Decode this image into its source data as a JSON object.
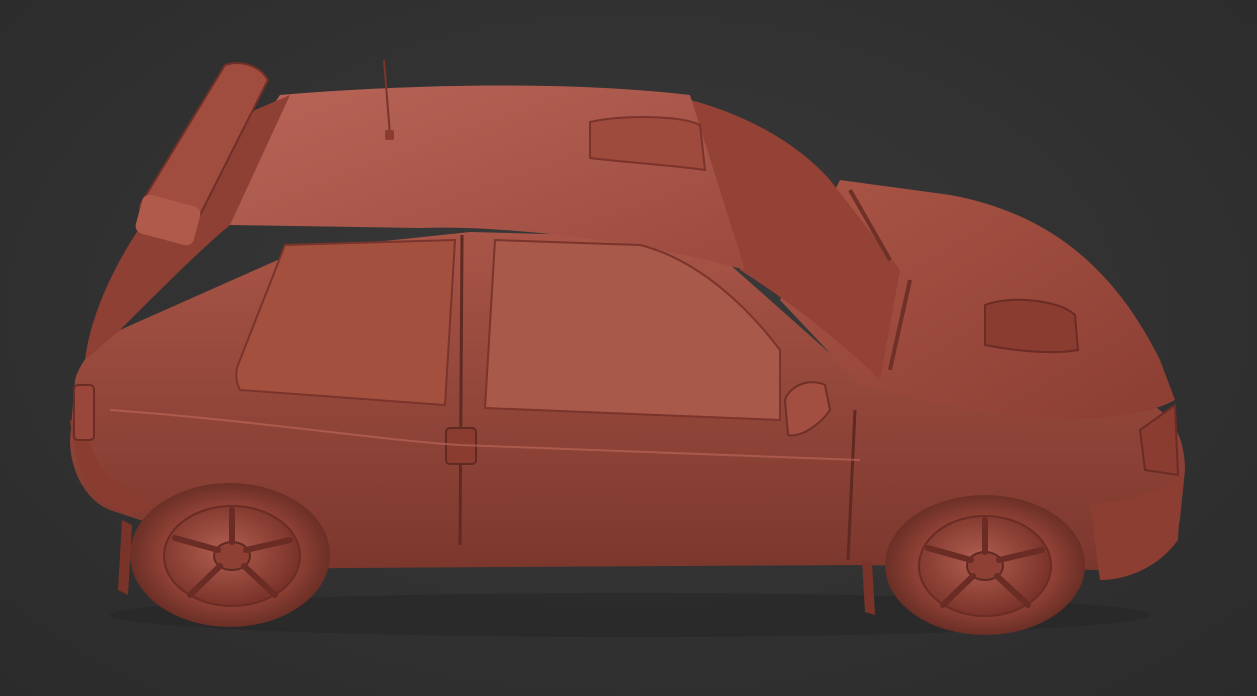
{
  "scene": {
    "subject": "car-sculpt-model",
    "background_color": "#333333",
    "material_color": "#9c4a3e",
    "material_highlight": "#b8675a",
    "material_shadow": "#5e2a22"
  }
}
